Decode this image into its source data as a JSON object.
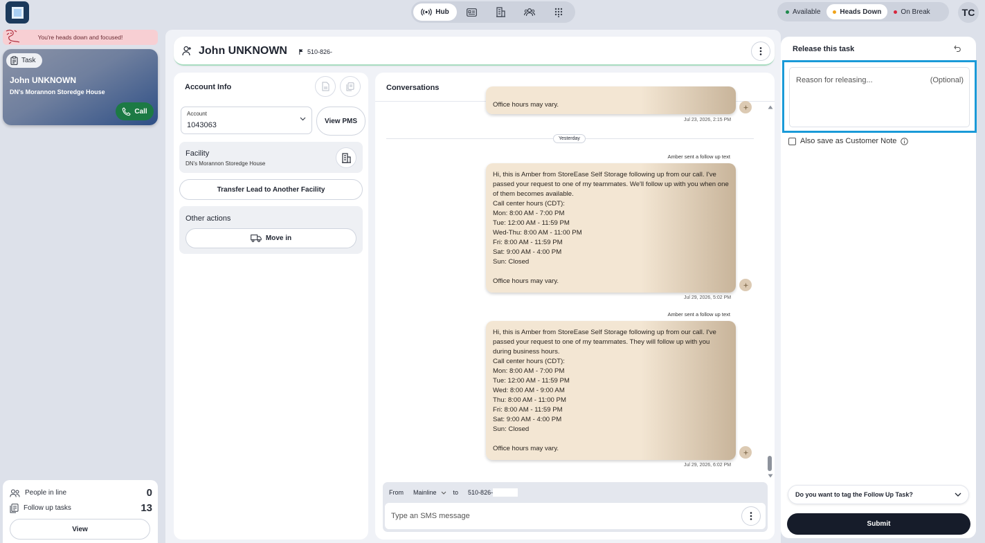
{
  "topbar": {
    "nav": {
      "hub_label": "Hub"
    },
    "status": [
      {
        "label": "Available",
        "color": "#1f8a4c",
        "active": false
      },
      {
        "label": "Heads Down",
        "color": "#f0a31a",
        "active": true
      },
      {
        "label": "On Break",
        "color": "#d7263d",
        "active": false
      }
    ],
    "avatar_initials": "TC"
  },
  "sidebar": {
    "focus_banner": "You're heads down and focused!",
    "task": {
      "chip": "Task",
      "name": "John UNKNOWN",
      "facility": "DN's Morannon Storedge House",
      "call_label": "Call"
    },
    "queue": {
      "people_in_line_label": "People in line",
      "people_in_line_count": "0",
      "follow_up_label": "Follow up tasks",
      "follow_up_count": "13",
      "view_label": "View"
    }
  },
  "header": {
    "name": "John UNKNOWN",
    "phone": "510-826-"
  },
  "account": {
    "title": "Account Info",
    "account_label": "Account",
    "account_value": "1043063",
    "view_pms": "View PMS",
    "facility_label": "Facility",
    "facility_value": "DN's Morannon Storedge House",
    "transfer_label": "Transfer Lead to Another Facility",
    "other_actions_label": "Other actions",
    "move_in_label": "Move in"
  },
  "conversations": {
    "title": "Conversations",
    "top_bubble_tail": "Office hours may vary.",
    "top_bubble_time": "Jul 23, 2026, 2:15 PM",
    "divider": "Yesterday",
    "messages": [
      {
        "sender": "Amber sent a follow up text",
        "text": "Hi, this is Amber from StoreEase Self Storage following up from our call. I've passed your request to one of my teammates. We'll follow up with you when one of them becomes available.\nCall center hours (CDT):\nMon: 8:00 AM - 7:00 PM\nTue: 12:00 AM - 11:59 PM\nWed-Thu: 8:00 AM - 11:00 PM\nFri: 8:00 AM - 11:59 PM\nSat: 9:00 AM - 4:00 PM\nSun: Closed\n\nOffice hours may vary.",
        "time": "Jul 29, 2026, 5:02 PM"
      },
      {
        "sender": "Amber sent a follow up text",
        "text": "Hi, this is Amber from StoreEase Self Storage following up from our call. I've passed your request to one of my teammates. They will follow up with you during business hours.\nCall center hours (CDT):\nMon: 8:00 AM - 7:00 PM\nTue: 12:00 AM - 11:59 PM\nWed: 8:00 AM - 9:00 AM\nThu: 8:00 AM - 11:00 PM\nFri: 8:00 AM - 11:59 PM\nSat: 9:00 AM - 4:00 PM\nSun: Closed\n\nOffice hours may vary.",
        "time": "Jul 29, 2026, 6:02 PM"
      }
    ],
    "composer": {
      "from_label": "From",
      "line": "Mainline",
      "to_label": "to",
      "to_number": "510-826-",
      "placeholder": "Type an SMS message"
    }
  },
  "release_panel": {
    "title": "Release this task",
    "reason_placeholder": "Reason for releasing...",
    "optional": "(Optional)",
    "save_note_label": "Also save as Customer Note",
    "tag_question": "Do you want to tag the Follow Up Task?",
    "submit_label": "Submit"
  }
}
